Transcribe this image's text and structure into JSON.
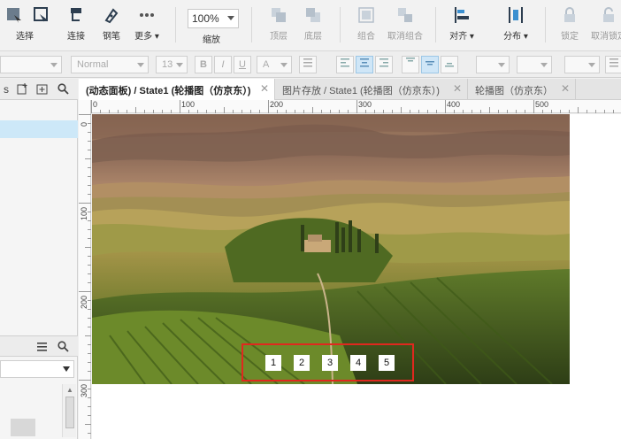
{
  "toolbar": {
    "tools": [
      {
        "id": "select",
        "label": "选择"
      },
      {
        "id": "connect",
        "label": "连接"
      },
      {
        "id": "pen",
        "label": "钢笔"
      },
      {
        "id": "more",
        "label": "更多 ▾"
      }
    ],
    "zoom": {
      "value": "100%",
      "label": "缩放"
    },
    "arrange_tools": [
      {
        "id": "bring-front",
        "label": "顶层"
      },
      {
        "id": "send-back",
        "label": "底层"
      },
      {
        "id": "group",
        "label": "组合"
      },
      {
        "id": "ungroup",
        "label": "取消组合"
      },
      {
        "id": "align",
        "label": "对齐 ▾"
      },
      {
        "id": "distribute",
        "label": "分布 ▾"
      },
      {
        "id": "lock",
        "label": "锁定"
      },
      {
        "id": "unlock",
        "label": "取消锁定"
      }
    ]
  },
  "format_bar": {
    "font_style": "Normal",
    "font_size": "13",
    "bold": "B",
    "italic": "I",
    "underline": "U",
    "font_color": "A"
  },
  "tabs": [
    {
      "label": "(动态面板) / State1 (轮播图（仿京东）)",
      "active": true
    },
    {
      "label": "图片存放 / State1 (轮播图（仿京东）)",
      "active": false
    },
    {
      "label": "轮播图（仿京东）",
      "active": false
    }
  ],
  "rulers": {
    "h_labels": [
      "0",
      "100",
      "200",
      "300",
      "400",
      "500"
    ],
    "v_labels": [
      "0",
      "100",
      "200",
      "300"
    ]
  },
  "carousel": {
    "page_buttons": [
      "1",
      "2",
      "3",
      "4",
      "5"
    ],
    "highlight_color": "#e0281e"
  },
  "colors": {
    "accent": "#3a8fd0",
    "selection_blue": "#cde8f8"
  }
}
